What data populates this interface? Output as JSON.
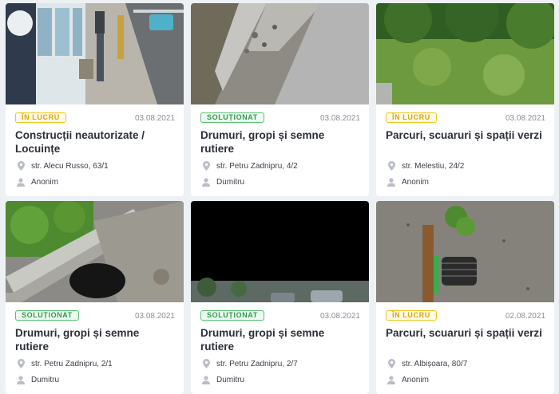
{
  "cards": [
    {
      "status": "ÎN LUCRU",
      "status_type": "lucru",
      "date": "03.08.2021",
      "title": "Construcții neautorizate / Locuințe",
      "address": "str. Alecu Russo, 63/1",
      "author": "Anonim",
      "photo": "street-sidewalk-person"
    },
    {
      "status": "SOLUȚIONAT",
      "status_type": "sol",
      "date": "03.08.2021",
      "title": "Drumuri, gropi și semne rutiere",
      "address": "str. Petru Zadnipru, 4/2",
      "author": "Dumitru",
      "photo": "broken-curb-asphalt"
    },
    {
      "status": "ÎN LUCRU",
      "status_type": "lucru",
      "date": "03.08.2021",
      "title": "Parcuri, scuaruri și spații verzi",
      "address": "str. Melestiu, 24/2",
      "author": "Anonim",
      "photo": "overgrown-greenery"
    },
    {
      "status": "SOLUȚIONAT",
      "status_type": "sol",
      "date": "03.08.2021",
      "title": "Drumuri, gropi și semne rutiere",
      "address": "str. Petru Zadnipru, 2/1",
      "author": "Dumitru",
      "photo": "open-manhole-curb"
    },
    {
      "status": "SOLUȚIONAT",
      "status_type": "sol",
      "date": "03.08.2021",
      "title": "Drumuri, gropi și semne rutiere",
      "address": "str. Petru Zadnipru, 2/7",
      "author": "Dumitru",
      "photo": "dark-street-photo"
    },
    {
      "status": "ÎN LUCRU",
      "status_type": "lucru",
      "date": "02.08.2021",
      "title": "Parcuri, scuaruri și spații verzi",
      "address": "str. Albișoara, 80/7",
      "author": "Anonim",
      "photo": "playground-spring-toy"
    }
  ],
  "colors": {
    "in_lucru": "#f0c419",
    "solutionat": "#58c06f",
    "title": "#2b2f3a",
    "icon": "#b9bec7"
  }
}
